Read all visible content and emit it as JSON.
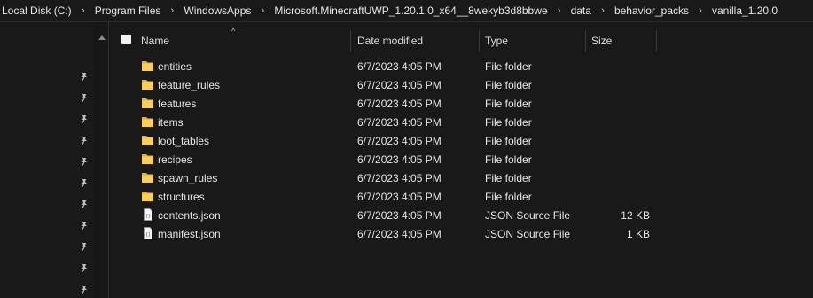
{
  "breadcrumb": {
    "items": [
      "Local Disk (C:)",
      "Program Files",
      "WindowsApps",
      "Microsoft.MinecraftUWP_1.20.1.0_x64__8wekyb3d8bbwe",
      "data",
      "behavior_packs",
      "vanilla_1.20.0"
    ],
    "separator_icon": "chevron-right-icon"
  },
  "columns": {
    "name": "Name",
    "date_modified": "Date modified",
    "type": "Type",
    "size": "Size"
  },
  "files": [
    {
      "name": "entities",
      "date": "6/7/2023 4:05 PM",
      "type": "File folder",
      "size": "",
      "icon": "folder-icon"
    },
    {
      "name": "feature_rules",
      "date": "6/7/2023 4:05 PM",
      "type": "File folder",
      "size": "",
      "icon": "folder-icon"
    },
    {
      "name": "features",
      "date": "6/7/2023 4:05 PM",
      "type": "File folder",
      "size": "",
      "icon": "folder-icon"
    },
    {
      "name": "items",
      "date": "6/7/2023 4:05 PM",
      "type": "File folder",
      "size": "",
      "icon": "folder-icon"
    },
    {
      "name": "loot_tables",
      "date": "6/7/2023 4:05 PM",
      "type": "File folder",
      "size": "",
      "icon": "folder-icon"
    },
    {
      "name": "recipes",
      "date": "6/7/2023 4:05 PM",
      "type": "File folder",
      "size": "",
      "icon": "folder-icon"
    },
    {
      "name": "spawn_rules",
      "date": "6/7/2023 4:05 PM",
      "type": "File folder",
      "size": "",
      "icon": "folder-icon"
    },
    {
      "name": "structures",
      "date": "6/7/2023 4:05 PM",
      "type": "File folder",
      "size": "",
      "icon": "folder-icon"
    },
    {
      "name": "contents.json",
      "date": "6/7/2023 4:05 PM",
      "type": "JSON Source File",
      "size": "12 KB",
      "icon": "json-file-icon"
    },
    {
      "name": "manifest.json",
      "date": "6/7/2023 4:05 PM",
      "type": "JSON Source File",
      "size": "1 KB",
      "icon": "json-file-icon"
    }
  ],
  "pinned_items_icon": "pin-icon",
  "colors": {
    "background": "#191919",
    "folder": "#f5c542",
    "text": "#e6e6e6"
  }
}
